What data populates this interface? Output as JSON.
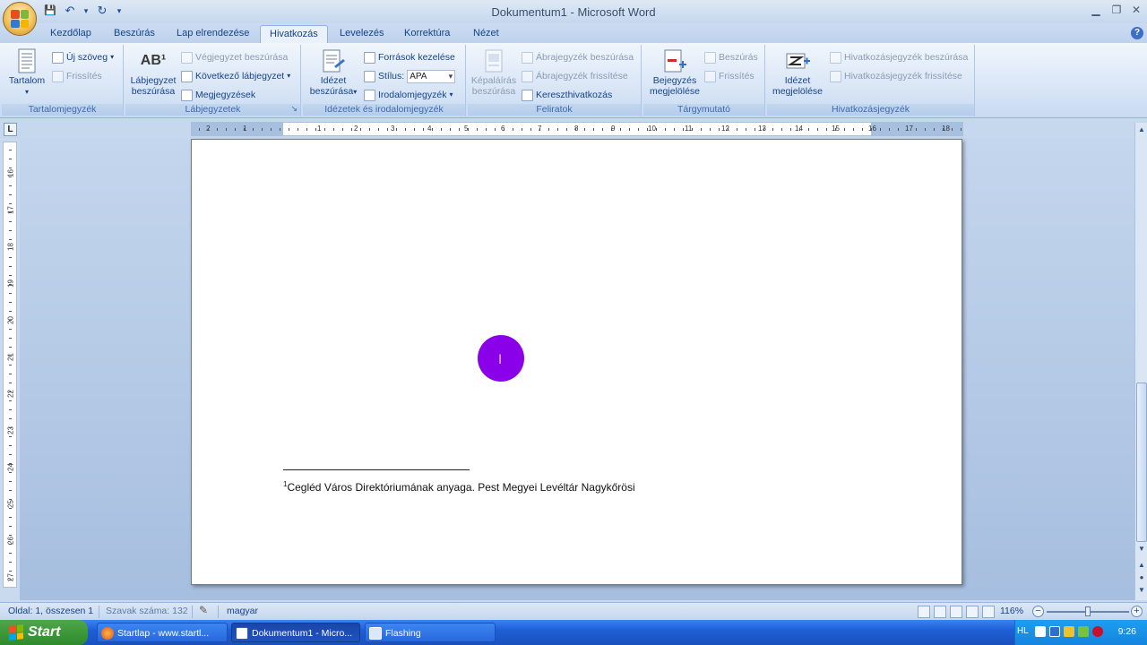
{
  "window": {
    "title": "Dokumentum1 - Microsoft Word",
    "minimize": "▁",
    "restore": "❐",
    "close": "✕"
  },
  "qat": {
    "save": "💾",
    "undo": "↶",
    "undo_arrow": "▾",
    "redo": "↻",
    "customize": "▾"
  },
  "tabs": [
    {
      "label": "Kezdőlap"
    },
    {
      "label": "Beszúrás"
    },
    {
      "label": "Lap elrendezése"
    },
    {
      "label": "Hivatkozás"
    },
    {
      "label": "Levelezés"
    },
    {
      "label": "Korrektúra"
    },
    {
      "label": "Nézet"
    }
  ],
  "help": "?",
  "ribbon": {
    "toc": {
      "label": "Tartalomjegyzék",
      "big": "Tartalom",
      "add_text": "Új szöveg",
      "refresh": "Frissítés"
    },
    "footnotes": {
      "label": "Lábjegyzetek",
      "big_line1": "Lábjegyzet",
      "big_line2": "beszúrása",
      "big_icon": "AB¹",
      "insert_endnote": "Végjegyzet beszúrása",
      "next_footnote": "Következő lábjegyzet",
      "show_notes": "Megjegyzések",
      "launcher": "↘"
    },
    "citations": {
      "label": "Idézetek és irodalomjegyzék",
      "big_line1": "Idézet",
      "big_line2": "beszúrása",
      "manage_sources": "Források kezelése",
      "style_label": "Stílus:",
      "style_value": "APA",
      "bibliography": "Irodalomjegyzék"
    },
    "captions": {
      "label": "Feliratok",
      "big_line1": "Képaláírás",
      "big_line2": "beszúrása",
      "insert_table_figures": "Ábrajegyzék beszúrása",
      "update_table": "Ábrajegyzék frissítése",
      "cross_reference": "Kereszthivatkozás"
    },
    "index": {
      "label": "Tárgymutató",
      "big_line1": "Bejegyzés",
      "big_line2": "megjelölése",
      "insert": "Beszúrás",
      "update": "Frissítés"
    },
    "toa": {
      "label": "Hivatkozásjegyzék",
      "big_line1": "Idézet",
      "big_line2": "megjelölése",
      "insert": "Hivatkozásjegyzék beszúrása",
      "update": "Hivatkozásjegyzék frissítése"
    }
  },
  "ruler": {
    "tab_selector": "L",
    "h_numbers": [
      "2",
      "1",
      "1",
      "2",
      "3",
      "4",
      "5",
      "6",
      "7",
      "8",
      "9",
      "10",
      "11",
      "12",
      "13",
      "14",
      "15",
      "16",
      "17",
      "18"
    ],
    "v_numbers": [
      "16",
      "17",
      "18",
      "19",
      "20",
      "21",
      "22",
      "23",
      "24",
      "25",
      "26",
      "27"
    ]
  },
  "document": {
    "footnote_mark": "1",
    "footnote_text": "Cegléd Város Direktóriumának anyaga. Pest Megyei Levéltár Nagykőrösi",
    "ibeam": "I"
  },
  "statusbar": {
    "page": "Oldal: 1, összesen 1",
    "words": "Szavak száma: 132",
    "language": "magyar",
    "zoom": "116%",
    "zoom_out": "−",
    "zoom_in": "+"
  },
  "taskbar": {
    "start": "Start",
    "tasks": [
      {
        "label": "Startlap - www.startl..."
      },
      {
        "label": "Dokumentum1 - Micro..."
      },
      {
        "label": "Flashing"
      }
    ],
    "lang": "HL",
    "clock": "9:26"
  },
  "colors": {
    "accent": "#15428b",
    "cursor_circle": "#8a00e8",
    "taskbar": "#1f5fd6",
    "start": "#2e8a2b"
  }
}
